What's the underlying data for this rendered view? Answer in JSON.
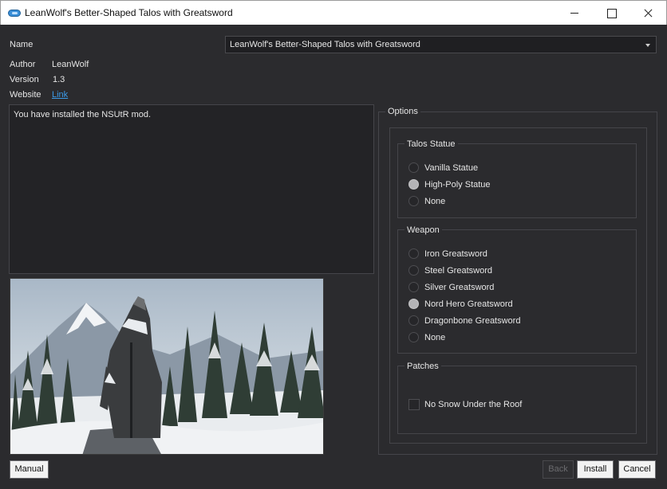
{
  "window": {
    "title": "LeanWolf's Better-Shaped Talos with Greatsword"
  },
  "info": {
    "name_label": "Name",
    "name_value": "LeanWolf's Better-Shaped Talos with Greatsword",
    "author_label": "Author",
    "author_value": "LeanWolf",
    "version_label": "Version",
    "version_value": "1.3",
    "website_label": "Website",
    "website_link": "Link"
  },
  "description": "You have installed the NSUtR mod.",
  "options": {
    "title": "Options",
    "groups": [
      {
        "title": "Talos Statue",
        "type": "radio",
        "items": [
          {
            "label": "Vanilla Statue",
            "checked": false
          },
          {
            "label": "High-Poly Statue",
            "checked": true
          },
          {
            "label": "None",
            "checked": false
          }
        ]
      },
      {
        "title": "Weapon",
        "type": "radio",
        "items": [
          {
            "label": "Iron Greatsword",
            "checked": false
          },
          {
            "label": "Steel Greatsword",
            "checked": false
          },
          {
            "label": "Silver Greatsword",
            "checked": false
          },
          {
            "label": "Nord Hero Greatsword",
            "checked": true
          },
          {
            "label": "Dragonbone Greatsword",
            "checked": false
          },
          {
            "label": "None",
            "checked": false
          }
        ]
      },
      {
        "title": "Patches",
        "type": "checkbox",
        "items": [
          {
            "label": "No Snow Under the Roof",
            "checked": false
          }
        ]
      }
    ]
  },
  "buttons": {
    "manual": "Manual",
    "back": "Back",
    "install": "Install",
    "cancel": "Cancel"
  },
  "colors": {
    "background": "#2b2b2e",
    "link": "#3b9be8",
    "radio_checked": "#b3b3b6"
  }
}
